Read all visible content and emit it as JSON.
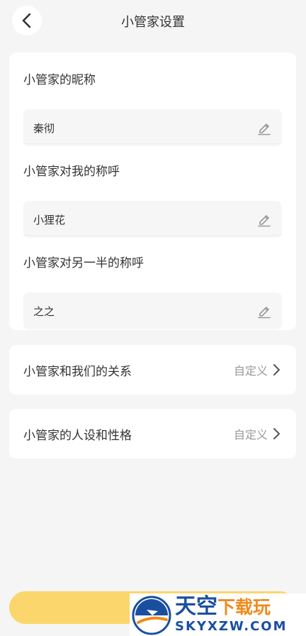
{
  "header": {
    "title": "小管家设置",
    "back_icon": "chevron-left-icon"
  },
  "fields": [
    {
      "label": "小管家的昵称",
      "value": "秦彻",
      "icon": "pencil-icon"
    },
    {
      "label": "小管家对我的称呼",
      "value": "小狸花",
      "icon": "pencil-icon"
    },
    {
      "label": "小管家对另一半的称呼",
      "value": "之之",
      "icon": "pencil-icon"
    }
  ],
  "rows": [
    {
      "label": "小管家和我们的关系",
      "value": "自定义",
      "icon": "chevron-right-icon"
    },
    {
      "label": "小管家的人设和性格",
      "value": "自定义",
      "icon": "chevron-right-icon"
    }
  ],
  "colors": {
    "background": "#f5f5f5",
    "card": "#ffffff",
    "accent": "#fbd66c",
    "muted_text": "#999999"
  },
  "watermark": {
    "title_part1": "天空",
    "title_part2": "下载玩",
    "subtitle": "SKYXZW.COM"
  }
}
